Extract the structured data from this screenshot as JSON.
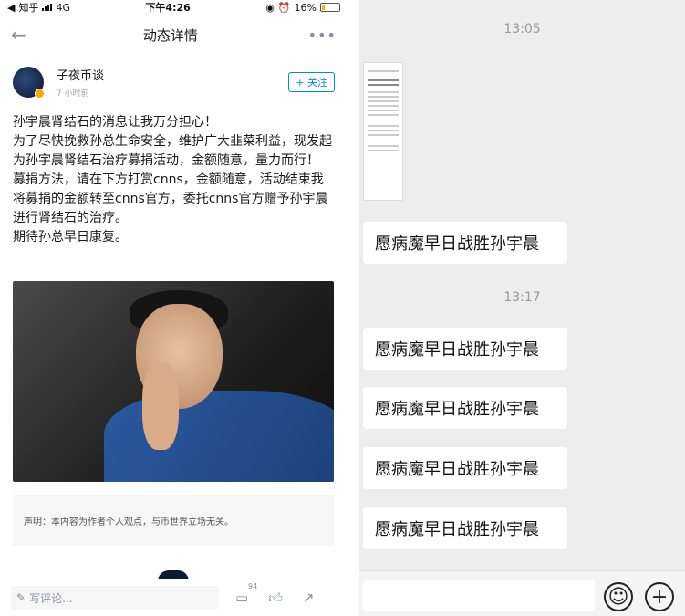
{
  "status_bar": {
    "app": "知乎",
    "network": "4G",
    "time": "下午4:26",
    "battery": "16%",
    "battery_level": 0.16
  },
  "nav": {
    "title": "动态详情"
  },
  "author": {
    "name": "子夜币谈",
    "time": "7 小时前",
    "follow_label": "+ 关注"
  },
  "post": {
    "paragraphs": [
      "孙宇晨肾结石的消息让我万分担心！",
      "为了尽快挽救孙总生命安全，维护广大韭菜利益，现发起为孙宇晨肾结石治疗募捐活动，金额随意，量力而行！",
      "募捐方法，请在下方打赏cnns，金额随意，活动结束我将募捐的金额转至cnns官方，委托cnns官方赠予孙宇晨进行肾结石的治疗。",
      "期待孙总早日康复。"
    ]
  },
  "disclaimer": "声明：本内容为作者个人观点，与币世界立场无关。",
  "bottom_bar": {
    "comment_placeholder": "写评论...",
    "comment_count": "94"
  },
  "chat": {
    "times": [
      "13:05",
      "13:17"
    ],
    "message": "愿病魔早日战胜孙宇晨",
    "bubbles_after_1305": 1,
    "bubbles_after_1317": 4
  }
}
